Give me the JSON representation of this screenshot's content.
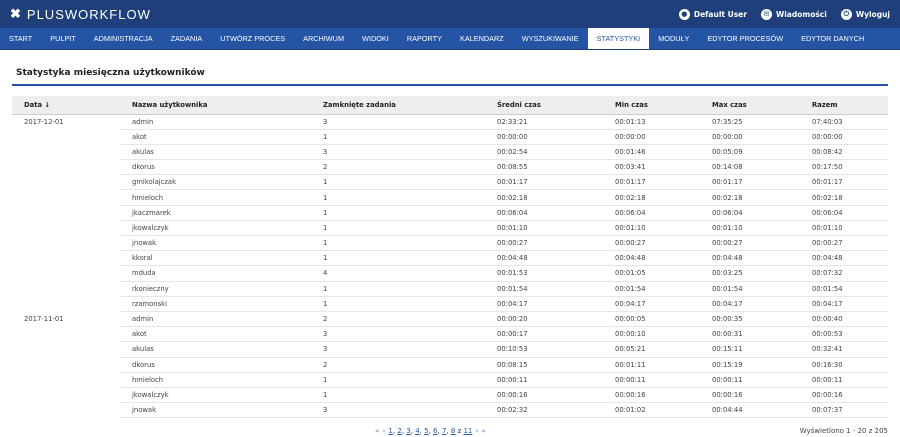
{
  "app": {
    "logo_mark": "✖",
    "logo_text": "PLUSWORKFLOW"
  },
  "user_bar": {
    "user_label": "Default User",
    "messages_label": "Wiadomości",
    "logout_label": "Wyloguj"
  },
  "nav": [
    "START",
    "PULPIT",
    "ADMINISTRACJA",
    "ZADANIA",
    "UTWÓRZ PROCES",
    "ARCHIWUM",
    "WIDOKI",
    "RAPORTY",
    "KALENDARZ",
    "WYSZUKIWANIE",
    "STATYSTYKI",
    "MODUŁY",
    "EDYTOR PROCESÓW",
    "EDYTOR DANYCH"
  ],
  "nav_active": "STATYSTYKI",
  "section_title": "Statystyka miesięczna użytkowników",
  "table": {
    "headers": [
      "Data",
      "Nazwa użytkownika",
      "Zamknięte zadania",
      "Średni czas",
      "Min czas",
      "Max czas",
      "Razem"
    ],
    "sort_indicator": "↓",
    "rows": [
      [
        "2017-12-01",
        "admin",
        "3",
        "02:33:21",
        "00:01:13",
        "07:35:25",
        "07:40:03"
      ],
      [
        "",
        "akot",
        "1",
        "00:00:00",
        "00:00:00",
        "00:00:00",
        "00:00:00"
      ],
      [
        "",
        "akulas",
        "3",
        "00:02:54",
        "00:01:46",
        "00:05:09",
        "00:08:42"
      ],
      [
        "",
        "dkorus",
        "2",
        "00:08:55",
        "00:03:41",
        "00:14:08",
        "00:17:50"
      ],
      [
        "",
        "gmikolajczak",
        "1",
        "00:01:17",
        "00:01:17",
        "00:01:17",
        "00:01:17"
      ],
      [
        "",
        "hmieloch",
        "1",
        "00:02:18",
        "00:02:18",
        "00:02:18",
        "00:02:18"
      ],
      [
        "",
        "jkaczmarek",
        "1",
        "00:06:04",
        "00:06:04",
        "00:06:04",
        "00:06:04"
      ],
      [
        "",
        "jkowalczyk",
        "1",
        "00:01:10",
        "00:01:10",
        "00:01:10",
        "00:01:10"
      ],
      [
        "",
        "jnowak",
        "1",
        "00:00:27",
        "00:00:27",
        "00:00:27",
        "00:00:27"
      ],
      [
        "",
        "kkoral",
        "1",
        "00:04:48",
        "00:04:48",
        "00:04:48",
        "00:04:48"
      ],
      [
        "",
        "mduda",
        "4",
        "00:01:53",
        "00:01:05",
        "00:03:25",
        "00:07:32"
      ],
      [
        "",
        "rkonieczny",
        "1",
        "00:01:54",
        "00:01:54",
        "00:01:54",
        "00:01:54"
      ],
      [
        "",
        "rzamonski",
        "1",
        "00:04:17",
        "00:04:17",
        "00:04:17",
        "00:04:17"
      ],
      [
        "2017-11-01",
        "admin",
        "2",
        "00:00:20",
        "00:00:05",
        "00:00:35",
        "00:00:40"
      ],
      [
        "",
        "akot",
        "3",
        "00:00:17",
        "00:00:10",
        "00:00:31",
        "00:00:53"
      ],
      [
        "",
        "akulas",
        "3",
        "00:10:53",
        "00:05:21",
        "00:15:11",
        "00:32:41"
      ],
      [
        "",
        "dkorus",
        "2",
        "00:08:15",
        "00:01:11",
        "00:15:19",
        "00:16:30"
      ],
      [
        "",
        "hmieloch",
        "1",
        "00:00:11",
        "00:00:11",
        "00:00:11",
        "00:00:11"
      ],
      [
        "",
        "jkowalczyk",
        "1",
        "00:00:16",
        "00:00:16",
        "00:00:16",
        "00:00:16"
      ],
      [
        "",
        "jnowak",
        "3",
        "00:02:32",
        "00:01:02",
        "00:04:44",
        "00:07:37"
      ]
    ]
  },
  "pagination": {
    "first": "«",
    "prev": "‹",
    "pages": [
      "1",
      "2",
      "3",
      "4",
      "5",
      "6",
      "7",
      "8"
    ],
    "separator": ",",
    "of_label": "z",
    "total_pages": "11",
    "next": "›",
    "last": "»",
    "summary": "Wyświetlono 1 - 20 z 205"
  },
  "colors": {
    "header_bg": "#1e3f7a",
    "nav_bg": "#2554a5",
    "accent": "#2554a5"
  }
}
